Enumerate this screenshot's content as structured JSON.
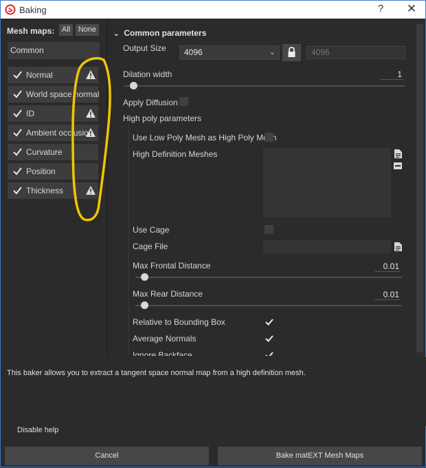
{
  "window": {
    "title": "Baking",
    "help_glyph": "?",
    "close_glyph": "✕"
  },
  "mesh_maps": {
    "label": "Mesh maps:",
    "all_button": "All",
    "none_button": "None",
    "common_tab": "Common",
    "items": [
      {
        "label": "Normal",
        "checked": true,
        "warning": true
      },
      {
        "label": "World space normal",
        "checked": true,
        "warning": false
      },
      {
        "label": "ID",
        "checked": true,
        "warning": true
      },
      {
        "label": "Ambient occlusion",
        "checked": true,
        "warning": true
      },
      {
        "label": "Curvature",
        "checked": true,
        "warning": false
      },
      {
        "label": "Position",
        "checked": true,
        "warning": false
      },
      {
        "label": "Thickness",
        "checked": true,
        "warning": true
      }
    ]
  },
  "common": {
    "section_title": "Common parameters",
    "output_size_label": "Output Size",
    "output_size_value": "4096",
    "output_size_linked_value": "4096",
    "dilation_label": "Dilation width",
    "dilation_value": "1",
    "dilation_level": 0.02,
    "apply_diffusion_label": "Apply Diffusion",
    "apply_diffusion_checked": false,
    "high_poly_label": "High poly parameters",
    "use_low_poly_label": "Use Low Poly Mesh as High Poly Mesh",
    "use_low_poly_checked": false,
    "hd_meshes_label": "High Definition Meshes",
    "use_cage_label": "Use Cage",
    "use_cage_checked": false,
    "cage_file_label": "Cage File",
    "max_frontal_label": "Max Frontal Distance",
    "max_frontal_value": "0.01",
    "max_frontal_level": 0.02,
    "max_rear_label": "Max Rear Distance",
    "max_rear_value": "0.01",
    "max_rear_level": 0.02,
    "relative_bbox_label": "Relative to Bounding Box",
    "relative_bbox_checked": true,
    "average_normals_label": "Average Normals",
    "average_normals_checked": true,
    "ignore_backface_label": "Ignore Backface",
    "ignore_backface_checked": true
  },
  "help": {
    "text": "This baker allows you to extract a tangent space normal map from a high definition mesh.",
    "disable_label": "Disable help"
  },
  "footer": {
    "cancel_label": "Cancel",
    "bake_label": "Bake matEXT Mesh Maps"
  },
  "colors": {
    "accent_border": "#3c79c9",
    "annotation": "#f2c500",
    "panel_bg": "#2b2b2b"
  }
}
